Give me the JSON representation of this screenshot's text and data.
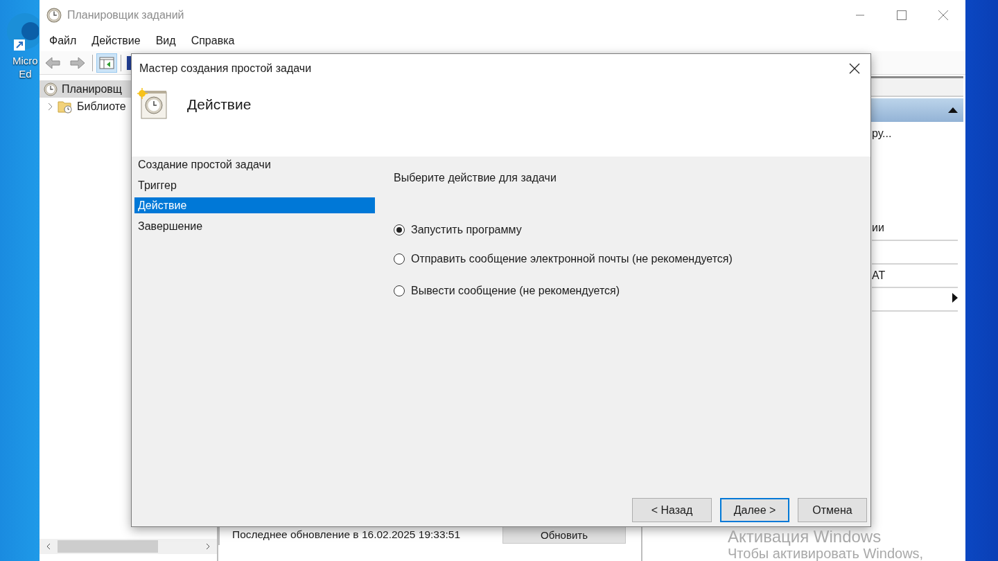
{
  "desktop": {
    "icon_label": [
      "Micro",
      "Ed"
    ]
  },
  "main_window": {
    "title": "Планировщик заданий",
    "menu": [
      "Файл",
      "Действие",
      "Вид",
      "Справка"
    ],
    "tree": [
      {
        "label": "Планировщ",
        "selected": true,
        "children": [
          {
            "label": "Библиоте",
            "selected": false,
            "expanded": false
          }
        ]
      }
    ],
    "actions": {
      "expanded": true,
      "items": [
        {
          "kind": "item",
          "label": "ру...",
          "divider": false
        },
        {
          "kind": "blank",
          "divider": false
        },
        {
          "kind": "blank",
          "divider": false
        },
        {
          "kind": "blank",
          "divider": false
        },
        {
          "kind": "item",
          "label": "ии",
          "divider": false
        },
        {
          "kind": "blank",
          "divider": true
        },
        {
          "kind": "item",
          "label": "АТ",
          "divider": true
        },
        {
          "kind": "submenu",
          "divider": true
        },
        {
          "kind": "blank",
          "divider": true
        }
      ]
    },
    "status": {
      "text": "Последнее обновление в 16.02.2025 19:33:51",
      "button": "Обновить"
    }
  },
  "dialog": {
    "title": "Мастер создания простой задачи",
    "heading": "Действие",
    "steps": [
      {
        "label": "Создание простой задачи",
        "selected": false
      },
      {
        "label": "Триггер",
        "selected": false
      },
      {
        "label": "Действие",
        "selected": true
      },
      {
        "label": "Завершение",
        "selected": false
      }
    ],
    "prompt": "Выберите действие для задачи",
    "options": [
      {
        "label": "Запустить программу",
        "selected": true
      },
      {
        "label": "Отправить сообщение электронной почты (не рекомендуется)",
        "selected": false
      },
      {
        "label": "Вывести сообщение (не рекомендуется)",
        "selected": false
      }
    ],
    "buttons": [
      {
        "label": "< Назад",
        "default": false
      },
      {
        "label": "Далее >",
        "default": true
      },
      {
        "label": "Отмена",
        "default": false
      }
    ]
  },
  "activation": [
    "Активация Windows",
    "Чтобы активировать Windows,"
  ]
}
